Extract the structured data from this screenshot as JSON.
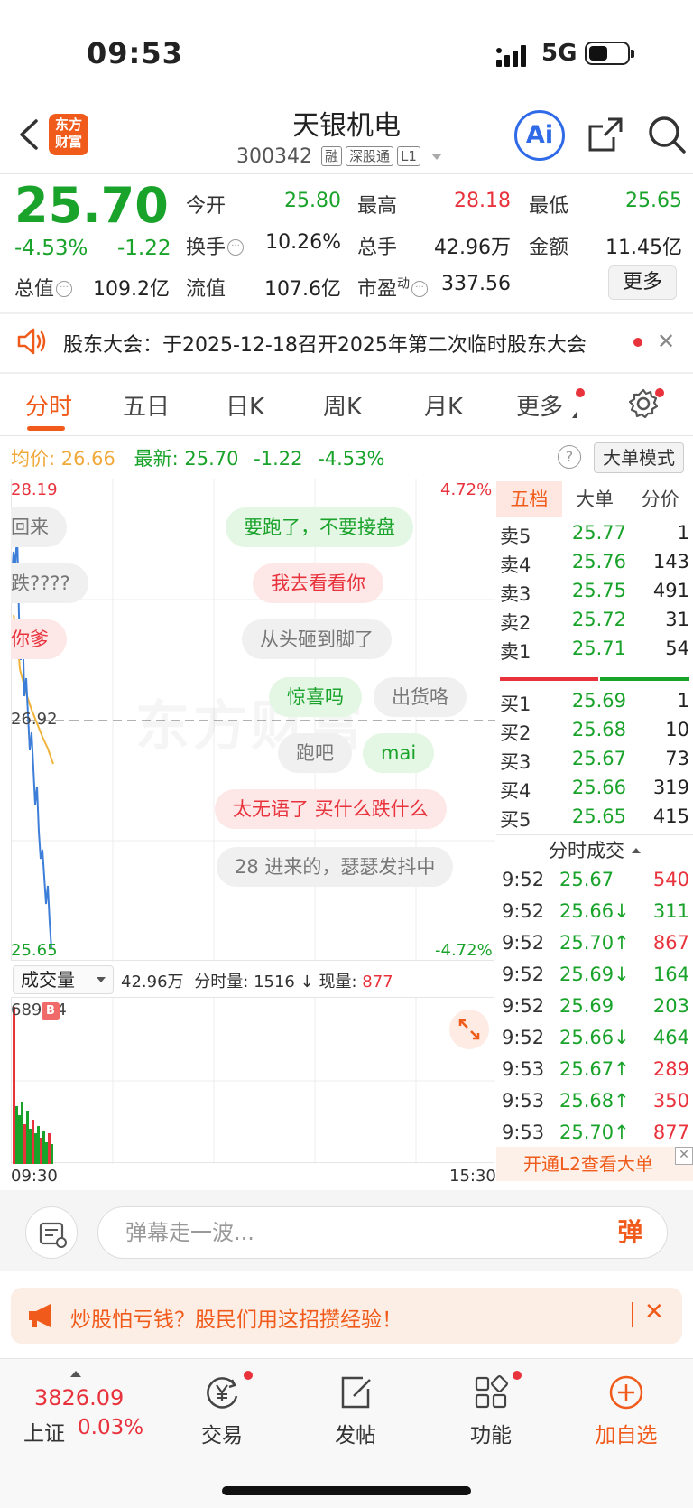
{
  "status": {
    "time": "09:53",
    "network": "5G"
  },
  "header": {
    "logo_line1": "东方",
    "logo_line2": "财富",
    "stock_name": "天银机电",
    "stock_code": "300342",
    "tags": [
      "融",
      "深股通",
      "L1"
    ],
    "ai_label": "Ai"
  },
  "quote": {
    "price": "25.70",
    "change_pct": "-4.53%",
    "change": "-1.22",
    "open_label": "今开",
    "open": "25.80",
    "high_label": "最高",
    "high": "28.18",
    "low_label": "最低",
    "low": "25.65",
    "turnover_label": "换手",
    "turnover": "10.26%",
    "volume_label": "总手",
    "volume": "42.96万",
    "amount_label": "金额",
    "amount": "11.45亿",
    "mktcap_label": "总值",
    "mktcap": "109.2亿",
    "float_label": "流值",
    "float": "107.6亿",
    "pe_label": "市盈",
    "pe_sup": "动",
    "pe": "337.56",
    "more_label": "更多"
  },
  "notice": {
    "text": "股东大会：于2025-12-18召开2025年第二次临时股东大会"
  },
  "tabs": [
    "分时",
    "五日",
    "日K",
    "周K",
    "月K",
    "更多"
  ],
  "summary": {
    "avg_label": "均价:",
    "avg": "26.66",
    "latest_label": "最新:",
    "latest": "25.70",
    "chg": "-1.22",
    "pct": "-4.53%",
    "big_order_mode": "大单模式"
  },
  "chart": {
    "price_max": "28.19",
    "price_ref": "26.92",
    "price_min": "25.65",
    "pct_max": "4.72%",
    "pct_min": "-4.72%",
    "watermark": "东方财富",
    "vol_select": "成交量",
    "vol_total": "42.96万",
    "vol_detail_label": "分时量:",
    "vol_detail": "1516",
    "vol_now_label": "现量:",
    "vol_now": "877",
    "vol_max": "689",
    "vol_max_suffix": "4",
    "marker": "B",
    "time_start": "09:30",
    "time_end": "15:30",
    "danmu": [
      {
        "text": "回来",
        "style": "gray"
      },
      {
        "text": "要跑了，不要接盘",
        "style": "green"
      },
      {
        "text": "跌????",
        "style": "gray"
      },
      {
        "text": "我去看看你",
        "style": "red"
      },
      {
        "text": "你爹",
        "style": "red"
      },
      {
        "text": "从头砸到脚了",
        "style": "gray"
      },
      {
        "text": "惊喜吗",
        "style": "green"
      },
      {
        "text": "出货咯",
        "style": "gray"
      },
      {
        "text": "跑吧",
        "style": "gray"
      },
      {
        "text": "mai",
        "style": "green"
      },
      {
        "text": "太无语了 买什么跌什么",
        "style": "red"
      },
      {
        "text": "28 进来的，瑟瑟发抖中",
        "style": "gray"
      }
    ]
  },
  "orderbook": {
    "tabs": [
      "五档",
      "大单",
      "分价"
    ],
    "asks": [
      {
        "label": "卖5",
        "price": "25.77",
        "vol": "1"
      },
      {
        "label": "卖4",
        "price": "25.76",
        "vol": "143"
      },
      {
        "label": "卖3",
        "price": "25.75",
        "vol": "491"
      },
      {
        "label": "卖2",
        "price": "25.72",
        "vol": "31"
      },
      {
        "label": "卖1",
        "price": "25.71",
        "vol": "54"
      }
    ],
    "bids": [
      {
        "label": "买1",
        "price": "25.69",
        "vol": "1"
      },
      {
        "label": "买2",
        "price": "25.68",
        "vol": "10"
      },
      {
        "label": "买3",
        "price": "25.67",
        "vol": "73"
      },
      {
        "label": "买4",
        "price": "25.66",
        "vol": "319"
      },
      {
        "label": "买5",
        "price": "25.65",
        "vol": "415"
      }
    ],
    "trades_title": "分时成交",
    "trades": [
      {
        "time": "9:52",
        "price": "25.67",
        "vol": "540",
        "dir": ""
      },
      {
        "time": "9:52",
        "price": "25.66↓",
        "vol": "311",
        "dir": "down"
      },
      {
        "time": "9:52",
        "price": "25.70↑",
        "vol": "867",
        "dir": "up"
      },
      {
        "time": "9:52",
        "price": "25.69↓",
        "vol": "164",
        "dir": "down"
      },
      {
        "time": "9:52",
        "price": "25.69",
        "vol": "203",
        "dir": "down2"
      },
      {
        "time": "9:52",
        "price": "25.66↓",
        "vol": "464",
        "dir": "down"
      },
      {
        "time": "9:53",
        "price": "25.67↑",
        "vol": "289",
        "dir": "up"
      },
      {
        "time": "9:53",
        "price": "25.68↑",
        "vol": "350",
        "dir": "up"
      },
      {
        "time": "9:53",
        "price": "25.70↑",
        "vol": "877",
        "dir": "up"
      }
    ],
    "l2_banner": "开通L2查看大单"
  },
  "danmu_input": {
    "placeholder": "弹幕走一波...",
    "send_label": "弹"
  },
  "promo": {
    "text": "炒股怕亏钱？股民们用这招攒经验！"
  },
  "bottom_nav": {
    "index_value": "3826.09",
    "index_name": "上证",
    "index_pct": "0.03%",
    "items": [
      "交易",
      "发帖",
      "功能",
      "加自选"
    ]
  },
  "colors": {
    "up": "#e8323c",
    "down": "#1aa32b",
    "brand": "#f05a1a"
  }
}
